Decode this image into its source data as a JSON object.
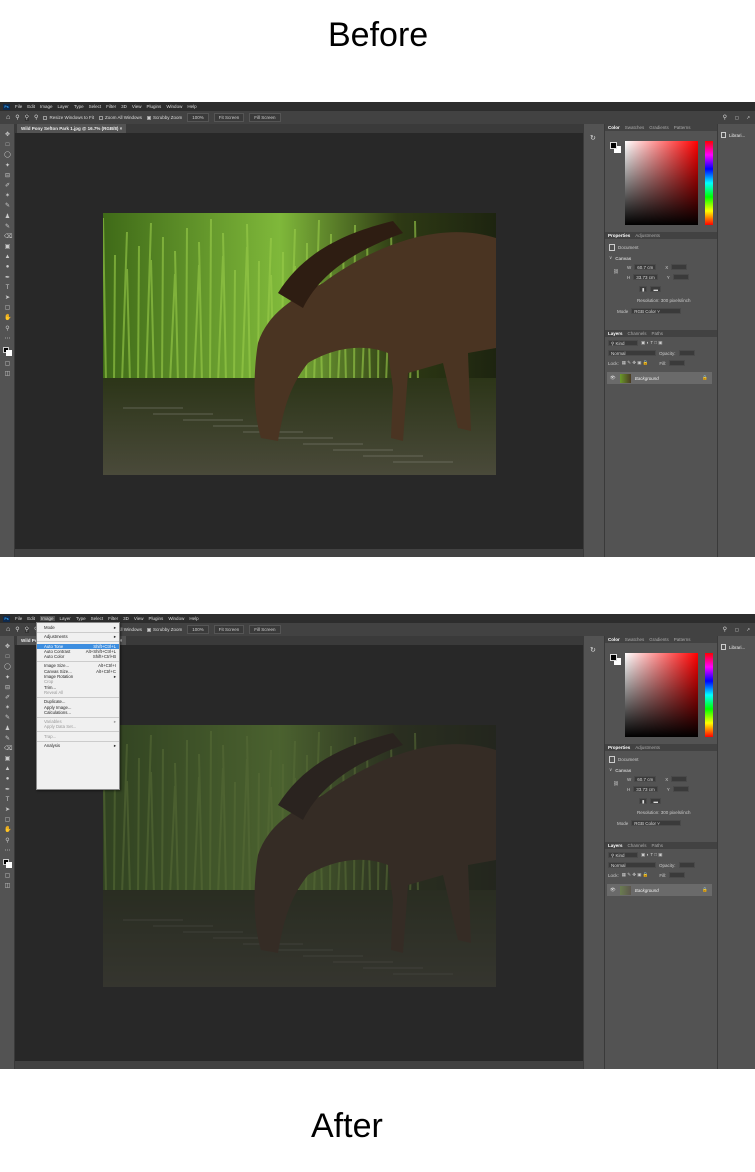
{
  "captions": {
    "before": "Before",
    "after": "After"
  },
  "app": {
    "logo": "Ps",
    "menus": [
      "File",
      "Edit",
      "Image",
      "Layer",
      "Type",
      "Select",
      "Filter",
      "3D",
      "View",
      "Plugins",
      "Window",
      "Help"
    ],
    "options": {
      "resize_windows": "Resize Windows to Fit",
      "zoom_all": "Zoom All Windows",
      "scrubby": "Scrubby Zoom",
      "zoom_pct": "100%",
      "fit_screen": "Fit Screen",
      "fill_screen": "Fill Screen"
    },
    "doc_tab": "Wild Pony Sefton Park 1.jpg @ 16.7% (RGB/8)",
    "color_tabs": [
      "Color",
      "Swatches",
      "Gradients",
      "Patterns"
    ],
    "properties_tabs": [
      "Properties",
      "Adjustments"
    ],
    "document_label": "Document",
    "canvas_label": "Canvas",
    "width_label": "W",
    "width_value": "60.7 cm",
    "height_label": "H",
    "height_value": "33.73 cm",
    "x_label": "X",
    "y_label": "Y",
    "resolution": "Resolution: 300 pixels/inch",
    "mode_label": "Mode",
    "mode_value": "RGB Color",
    "layers_tabs": [
      "Layers",
      "Channels",
      "Paths"
    ],
    "kind": "Kind",
    "blend": "Normal",
    "opacity_label": "Opacity:",
    "lock_label": "Lock:",
    "fill_label": "Fill:",
    "layer_name": "Background",
    "libraries": "Librari..."
  },
  "image_menu": {
    "items": [
      {
        "label": "Mode",
        "shortcut": "",
        "sub": true
      },
      {
        "sep": true
      },
      {
        "label": "Adjustments",
        "shortcut": "",
        "sub": true
      },
      {
        "sep": true
      },
      {
        "label": "Auto Tone",
        "shortcut": "Shift+Ctrl+L",
        "selected": true
      },
      {
        "label": "Auto Contrast",
        "shortcut": "Alt+Shift+Ctrl+L"
      },
      {
        "label": "Auto Color",
        "shortcut": "Shift+Ctrl+B"
      },
      {
        "sep": true
      },
      {
        "label": "Image Size...",
        "shortcut": "Alt+Ctrl+I"
      },
      {
        "label": "Canvas Size...",
        "shortcut": "Alt+Ctrl+C"
      },
      {
        "label": "Image Rotation",
        "shortcut": "",
        "sub": true
      },
      {
        "label": "Crop",
        "shortcut": "",
        "disabled": true
      },
      {
        "label": "Trim...",
        "shortcut": ""
      },
      {
        "label": "Reveal All",
        "shortcut": "",
        "disabled": true
      },
      {
        "sep": true
      },
      {
        "label": "Duplicate...",
        "shortcut": ""
      },
      {
        "label": "Apply Image...",
        "shortcut": ""
      },
      {
        "label": "Calculations...",
        "shortcut": ""
      },
      {
        "sep": true
      },
      {
        "label": "Variables",
        "shortcut": "",
        "sub": true,
        "disabled": true
      },
      {
        "label": "Apply Data Set...",
        "shortcut": "",
        "disabled": true
      },
      {
        "sep": true
      },
      {
        "label": "Trap...",
        "shortcut": "",
        "disabled": true
      },
      {
        "sep": true
      },
      {
        "label": "Analysis",
        "shortcut": "",
        "sub": true
      }
    ]
  }
}
